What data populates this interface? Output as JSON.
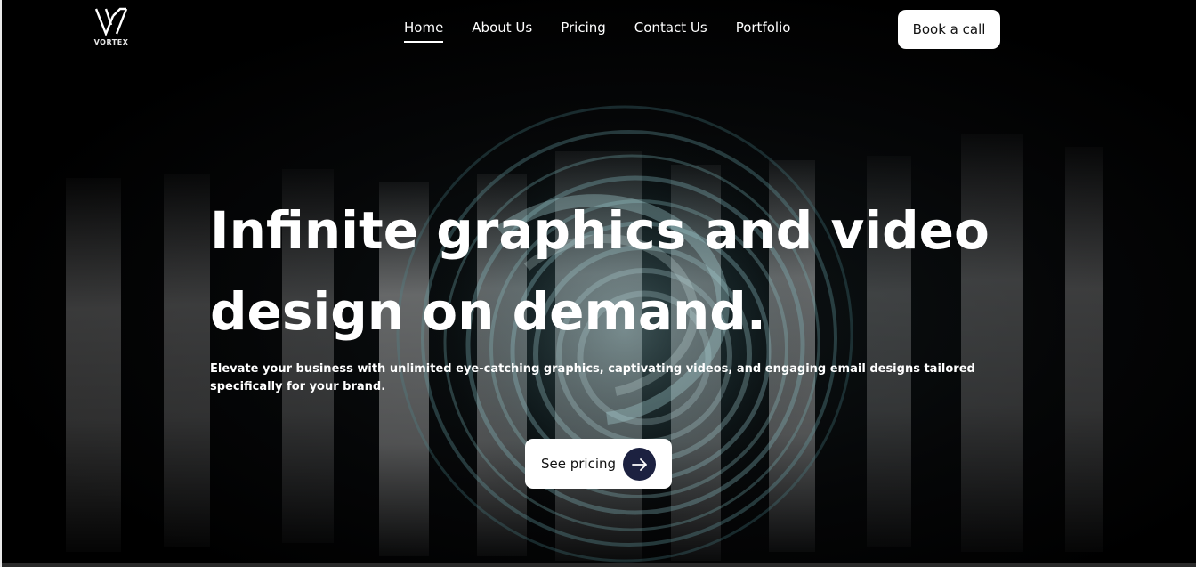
{
  "brand": {
    "name": "VORTEX"
  },
  "nav": {
    "items": [
      {
        "label": "Home",
        "active": true
      },
      {
        "label": "About Us",
        "active": false
      },
      {
        "label": "Pricing",
        "active": false
      },
      {
        "label": "Contact Us",
        "active": false
      },
      {
        "label": "Portfolio",
        "active": false
      }
    ],
    "cta_label": "Book a call"
  },
  "hero": {
    "title_line1": "Infinite graphics and video",
    "title_line2": "design on demand.",
    "subtitle": "Elevate your business with unlimited eye-catching graphics, captivating videos, and engaging email designs tailored specifically for your brand.",
    "cta_label": "See pricing",
    "cta_icon": "arrow-right-icon"
  },
  "colors": {
    "background": "#000000",
    "text": "#ffffff",
    "button_bg": "#ffffff",
    "button_text": "#111111",
    "arrow_circle": "#1c2140",
    "accent_teal": "#5fa7ac"
  }
}
